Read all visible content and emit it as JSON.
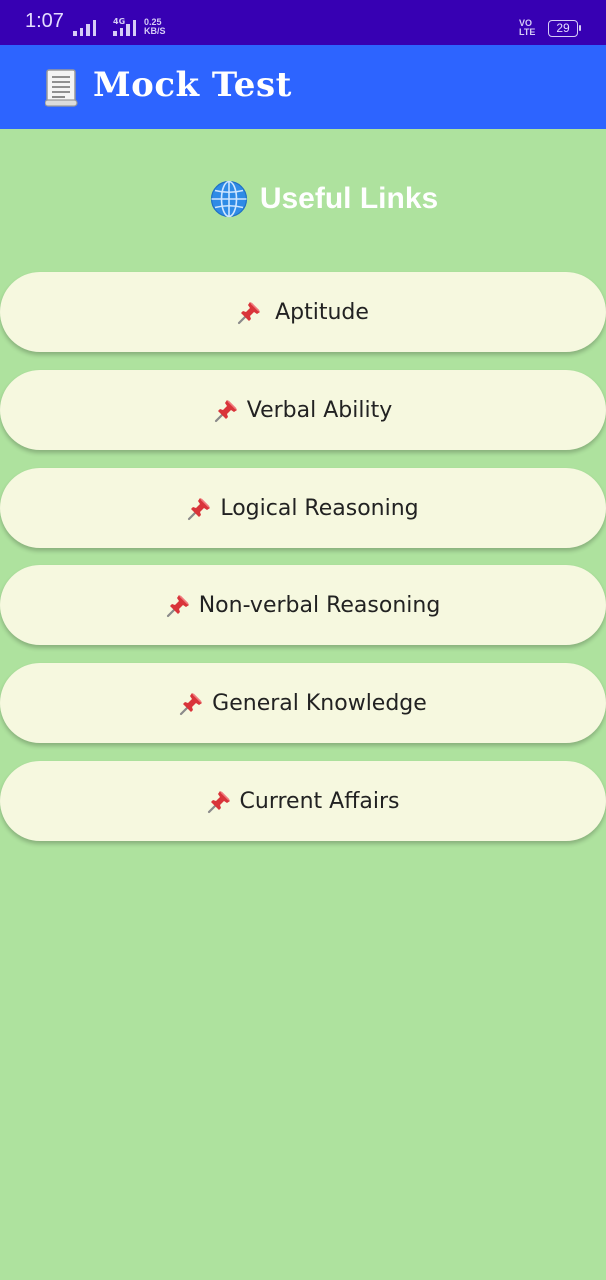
{
  "status_bar": {
    "time": "1:07",
    "network": "4G",
    "speed_value": "0.25",
    "speed_unit": "KB/S",
    "volte_top": "VO",
    "volte_bottom": "LTE",
    "battery": "29"
  },
  "app_bar": {
    "title": "Mock Test",
    "icon": "scroll-icon"
  },
  "heading": {
    "text": "Useful Links",
    "icon": "globe-icon"
  },
  "links": [
    {
      "label": "Aptitude",
      "icon": "pushpin-icon"
    },
    {
      "label": "Verbal Ability",
      "icon": "pushpin-icon"
    },
    {
      "label": "Logical Reasoning",
      "icon": "pushpin-icon"
    },
    {
      "label": "Non-verbal Reasoning",
      "icon": "pushpin-icon"
    },
    {
      "label": "General Knowledge",
      "icon": "pushpin-icon"
    },
    {
      "label": "Current Affairs",
      "icon": "pushpin-icon"
    }
  ],
  "colors": {
    "status_bar": "#3700b3",
    "app_bar": "#2d64ff",
    "background": "#aee29e",
    "button": "#f6f8df"
  }
}
